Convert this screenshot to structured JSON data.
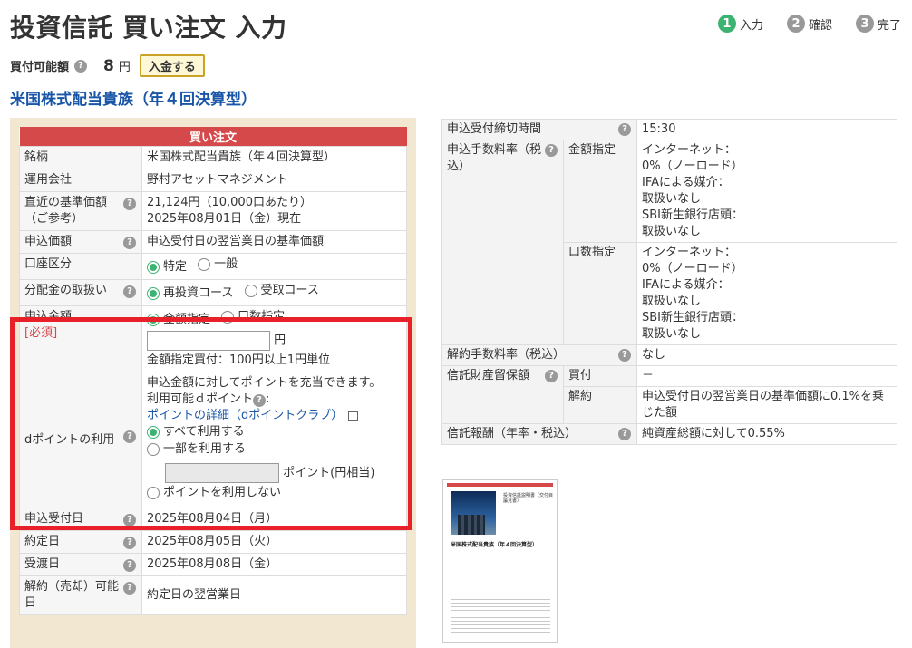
{
  "page_title": "投資信託 買い注文 入力",
  "steps": [
    {
      "num": "1",
      "label": "入力"
    },
    {
      "num": "2",
      "label": "確認"
    },
    {
      "num": "3",
      "label": "完了"
    }
  ],
  "balance": {
    "label": "買付可能額",
    "amount": "8",
    "unit": "円",
    "deposit_button": "入金する"
  },
  "fund_name": "米国株式配当貴族（年４回決算型）",
  "order_form": {
    "header": "買い注文",
    "rows": {
      "brand": {
        "label": "銘柄",
        "value": "米国株式配当貴族（年４回決算型）"
      },
      "company": {
        "label": "運用会社",
        "value": "野村アセットマネジメント"
      },
      "nav": {
        "label": "直近の基準価額（ご参考）",
        "line1": "21,124円（10,000口あたり）",
        "line2": "2025年08月01日（金）現在"
      },
      "price": {
        "label": "申込価額",
        "value": "申込受付日の翌営業日の基準価額"
      },
      "account": {
        "label": "口座区分",
        "opt1": "特定",
        "opt2": "一般"
      },
      "dividend": {
        "label": "分配金の取扱い",
        "opt1": "再投資コース",
        "opt2": "受取コース"
      },
      "amount": {
        "label": "申込金額",
        "required": "[必須]",
        "opt1": "金額指定",
        "opt2": "口数指定",
        "input_value": "",
        "unit": "円",
        "note": "金額指定買付：100円以上1円単位"
      },
      "dpoint": {
        "label": "dポイントの利用",
        "desc": "申込金額に対してポイントを充当できます。",
        "available": "利用可能ｄポイント",
        "available_colon": ":",
        "link": "ポイントの詳細（dポイントクラブ）",
        "opt_all": "すべて利用する",
        "opt_part": "一部を利用する",
        "point_input_value": "",
        "point_unit": "ポイント(円相当)",
        "opt_none": "ポイントを利用しない"
      },
      "apply_date": {
        "label": "申込受付日",
        "value": "2025年08月04日（月）"
      },
      "contract_date": {
        "label": "約定日",
        "value": "2025年08月05日（火）"
      },
      "delivery_date": {
        "label": "受渡日",
        "value": "2025年08月08日（金）"
      },
      "sell_date": {
        "label": "解約（売却）可能日",
        "value": "約定日の翌営業日"
      }
    }
  },
  "info": {
    "deadline": {
      "label": "申込受付締切時間",
      "value": "15:30"
    },
    "fee": {
      "label": "申込手数料率（税込）",
      "amount_label": "金額指定",
      "count_label": "口数指定",
      "lines": [
        "インターネット：",
        "0%（ノーロード）",
        "IFAによる媒介：",
        "取扱いなし",
        "SBI新生銀行店頭：",
        "取扱いなし"
      ]
    },
    "cancel_fee": {
      "label": "解約手数料率（税込）",
      "value": "なし"
    },
    "reserve": {
      "label": "信託財産留保額",
      "buy_label": "買付",
      "buy_value": "－",
      "sell_label": "解約",
      "sell_value": "申込受付日の翌営業日の基準価額に0.1%を乗じた額"
    },
    "trust_fee": {
      "label": "信託報酬（年率・税込）",
      "value": "純資産総額に対して0.55%"
    }
  },
  "thumbnail": {
    "title": "米国株式配当貴族（年４回決算型）",
    "doc_type": "投資信託説明書（交付目論見書）"
  },
  "colors": {
    "header_red": "#d6494a",
    "highlight_red": "#e8202a",
    "link_blue": "#1a56a7",
    "radio_green": "#3cb371",
    "panel_beige": "#f2e8d2"
  },
  "icons": {
    "help": "question-circle-icon",
    "external": "external-link-icon"
  }
}
